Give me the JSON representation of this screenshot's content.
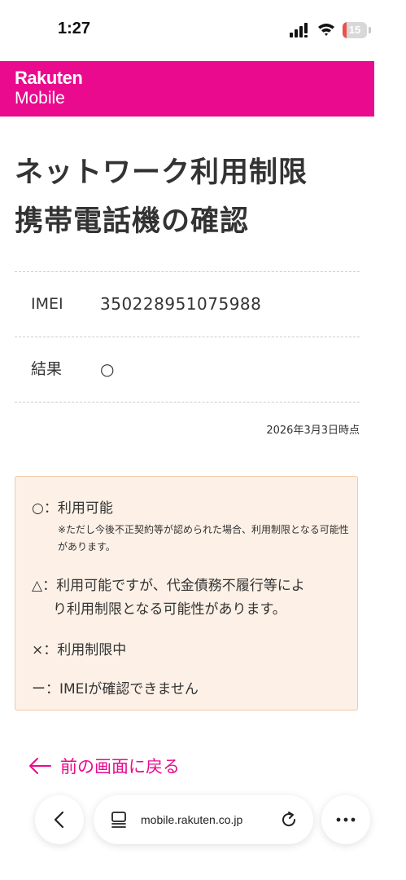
{
  "status_bar": {
    "time": "1:27",
    "battery_level": "15",
    "battery_fraction": 0.15,
    "icons": [
      "signal-icon",
      "wifi-icon",
      "battery-icon"
    ]
  },
  "header": {
    "logo_line1": "Rakuten",
    "logo_line2": "Mobile",
    "background_color": "#ea0a8e"
  },
  "page": {
    "title_line1": "ネットワーク利用制限",
    "title_line2": "携帯電話機の確認"
  },
  "result_table": {
    "rows": [
      {
        "label": "IMEI",
        "value": "350228951075988"
      },
      {
        "label": "結果",
        "value": "○"
      }
    ]
  },
  "timestamp": "2026年3月3日時点",
  "legend": {
    "items": [
      {
        "symbol": "○",
        "text": "：利用可能"
      },
      {
        "note": "※ただし今後不正契約等が認められた場合、利用制限となる可能性があります。"
      },
      {
        "symbol": "△",
        "text": "：利用可能ですが、代金債務不履行等によ",
        "continuation": "り利用制限となる可能性があります。"
      },
      {
        "symbol": "×",
        "text": "：利用制限中"
      },
      {
        "symbol": "ー",
        "text": "：IMEIが確認できません"
      }
    ]
  },
  "back_link": {
    "label": "前の画面に戻る",
    "color": "#ea0a8e"
  },
  "browser_bar": {
    "url": "mobile.rakuten.co.jp",
    "icons": [
      "chevron-left-icon",
      "tabs-icon",
      "reload-icon",
      "more-icon"
    ]
  }
}
